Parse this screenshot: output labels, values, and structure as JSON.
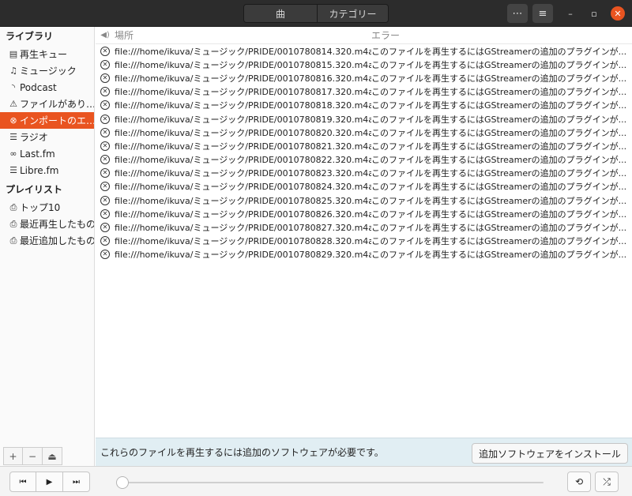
{
  "header": {
    "view_tabs": [
      {
        "label": "曲",
        "active": true
      },
      {
        "label": "カテゴリー",
        "active": false
      }
    ],
    "more_icon": "ellipsis-icon",
    "menu_icon": "hamburger-menu-icon"
  },
  "sidebar": {
    "library_heading": "ライブラリ",
    "library_items": [
      {
        "label": "再生キュー",
        "icon": "document-icon"
      },
      {
        "label": "ミュージック",
        "icon": "music-note-icon"
      },
      {
        "label": "Podcast",
        "icon": "rss-icon"
      },
      {
        "label": "ファイルがあり…",
        "icon": "warning-icon"
      },
      {
        "label": "インポートのエ…",
        "icon": "error-circle-icon",
        "active": true
      },
      {
        "label": "ラジオ",
        "icon": "radio-icon"
      },
      {
        "label": "Last.fm",
        "icon": "lastfm-icon"
      },
      {
        "label": "Libre.fm",
        "icon": "librefm-icon"
      }
    ],
    "playlist_heading": "プレイリスト",
    "playlist_items": [
      {
        "label": "トップ10",
        "icon": "smart-playlist-icon"
      },
      {
        "label": "最近再生したもの",
        "icon": "smart-playlist-icon"
      },
      {
        "label": "最近追加したもの",
        "icon": "smart-playlist-icon"
      }
    ]
  },
  "table": {
    "columns": {
      "location": "場所",
      "error": "エラー"
    },
    "rows": [
      {
        "location": "file:///home/ikuva/ミュージック/PRIDE/0010780814.320.m4a",
        "error": "このファイルを再生するにはGStreamerの追加のプラグインが..."
      },
      {
        "location": "file:///home/ikuva/ミュージック/PRIDE/0010780815.320.m4a",
        "error": "このファイルを再生するにはGStreamerの追加のプラグインが..."
      },
      {
        "location": "file:///home/ikuva/ミュージック/PRIDE/0010780816.320.m4a",
        "error": "このファイルを再生するにはGStreamerの追加のプラグインが..."
      },
      {
        "location": "file:///home/ikuva/ミュージック/PRIDE/0010780817.320.m4a",
        "error": "このファイルを再生するにはGStreamerの追加のプラグインが..."
      },
      {
        "location": "file:///home/ikuva/ミュージック/PRIDE/0010780818.320.m4a",
        "error": "このファイルを再生するにはGStreamerの追加のプラグインが..."
      },
      {
        "location": "file:///home/ikuva/ミュージック/PRIDE/0010780819.320.m4a",
        "error": "このファイルを再生するにはGStreamerの追加のプラグインが..."
      },
      {
        "location": "file:///home/ikuva/ミュージック/PRIDE/0010780820.320.m4a",
        "error": "このファイルを再生するにはGStreamerの追加のプラグインが..."
      },
      {
        "location": "file:///home/ikuva/ミュージック/PRIDE/0010780821.320.m4a",
        "error": "このファイルを再生するにはGStreamerの追加のプラグインが..."
      },
      {
        "location": "file:///home/ikuva/ミュージック/PRIDE/0010780822.320.m4a",
        "error": "このファイルを再生するにはGStreamerの追加のプラグインが..."
      },
      {
        "location": "file:///home/ikuva/ミュージック/PRIDE/0010780823.320.m4a",
        "error": "このファイルを再生するにはGStreamerの追加のプラグインが..."
      },
      {
        "location": "file:///home/ikuva/ミュージック/PRIDE/0010780824.320.m4a",
        "error": "このファイルを再生するにはGStreamerの追加のプラグインが..."
      },
      {
        "location": "file:///home/ikuva/ミュージック/PRIDE/0010780825.320.m4a",
        "error": "このファイルを再生するにはGStreamerの追加のプラグインが..."
      },
      {
        "location": "file:///home/ikuva/ミュージック/PRIDE/0010780826.320.m4a",
        "error": "このファイルを再生するにはGStreamerの追加のプラグインが..."
      },
      {
        "location": "file:///home/ikuva/ミュージック/PRIDE/0010780827.320.m4a",
        "error": "このファイルを再生するにはGStreamerの追加のプラグインが..."
      },
      {
        "location": "file:///home/ikuva/ミュージック/PRIDE/0010780828.320.m4a",
        "error": "このファイルを再生するにはGStreamerの追加のプラグインが..."
      },
      {
        "location": "file:///home/ikuva/ミュージック/PRIDE/0010780829.320.m4a",
        "error": "このファイルを再生するにはGStreamerの追加のプラグインが..."
      }
    ]
  },
  "infobar": {
    "message": "これらのファイルを再生するには追加のソフトウェアが必要です。",
    "install_button": "追加ソフトウェアをインストール"
  },
  "player": {
    "progress": 0,
    "accent_color": "#e95420"
  }
}
